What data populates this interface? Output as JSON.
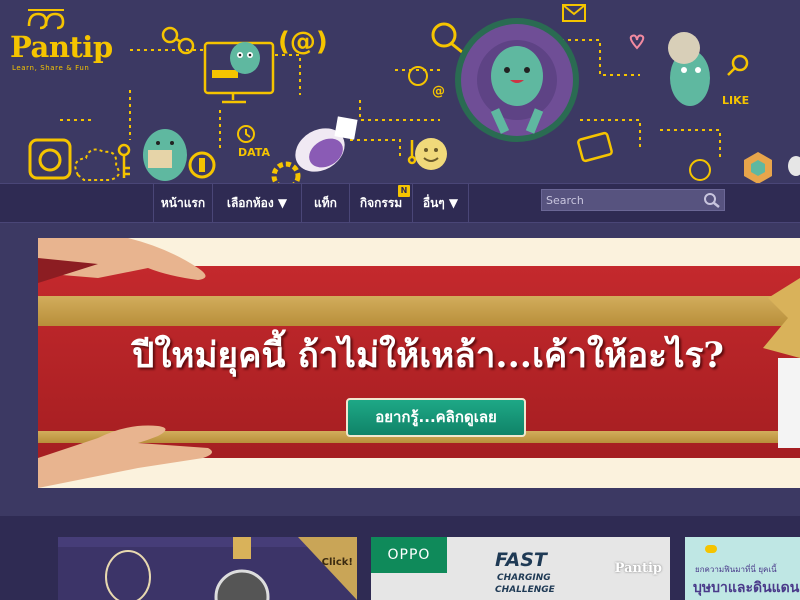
{
  "brand": {
    "name": "Pantip",
    "tagline": "Learn, Share & Fun"
  },
  "header_art": {
    "labels": [
      "DATA",
      "LIKE"
    ],
    "email_symbol": "(@)"
  },
  "nav": {
    "items": [
      {
        "label": "หน้าแรก"
      },
      {
        "label": "เลือกห้อง ▼"
      },
      {
        "label": "แท็ก"
      },
      {
        "label": "กิจกรรม",
        "badge": "N"
      },
      {
        "label": "อื่นๆ ▼"
      }
    ]
  },
  "search": {
    "placeholder": "Search"
  },
  "banner": {
    "headline": "ปีใหม่ยุคนี้ ถ้าไม่ให้เหล้า...เค้าให้อะไร?",
    "cta": "อยากรู้...คลิกดูเลย"
  },
  "cards": [
    {
      "badge": "Click!"
    },
    {
      "brand_left": "OPPO",
      "title_line1": "FAST",
      "title_line2": "CHARGING",
      "title_line3": "CHALLENGE",
      "brand_right": "Pantip"
    },
    {
      "text_line1": "ยกความฟินมาที่นี่ ยุคเนี้",
      "text_line2": "บุษบาและดินแดน"
    }
  ],
  "colors": {
    "background": "#3c3963",
    "nav": "#2f2b53",
    "brand_yellow": "#f5c400",
    "banner_red": "#c4292d",
    "cta_green": "#16977a",
    "mascot_green": "#5fb8a0"
  }
}
